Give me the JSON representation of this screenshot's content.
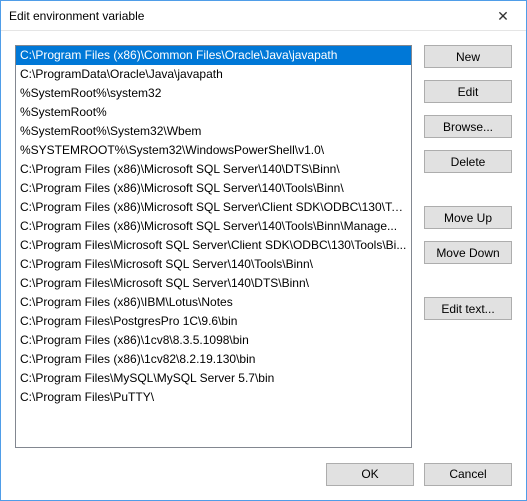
{
  "window": {
    "title": "Edit environment variable"
  },
  "list": {
    "selectedIndex": 0,
    "items": [
      "C:\\Program Files (x86)\\Common Files\\Oracle\\Java\\javapath",
      "C:\\ProgramData\\Oracle\\Java\\javapath",
      "%SystemRoot%\\system32",
      "%SystemRoot%",
      "%SystemRoot%\\System32\\Wbem",
      "%SYSTEMROOT%\\System32\\WindowsPowerShell\\v1.0\\",
      "C:\\Program Files (x86)\\Microsoft SQL Server\\140\\DTS\\Binn\\",
      "C:\\Program Files (x86)\\Microsoft SQL Server\\140\\Tools\\Binn\\",
      "C:\\Program Files (x86)\\Microsoft SQL Server\\Client SDK\\ODBC\\130\\To...",
      "C:\\Program Files (x86)\\Microsoft SQL Server\\140\\Tools\\Binn\\Manage...",
      "C:\\Program Files\\Microsoft SQL Server\\Client SDK\\ODBC\\130\\Tools\\Bi...",
      "C:\\Program Files\\Microsoft SQL Server\\140\\Tools\\Binn\\",
      "C:\\Program Files\\Microsoft SQL Server\\140\\DTS\\Binn\\",
      "C:\\Program Files (x86)\\IBM\\Lotus\\Notes",
      "C:\\Program Files\\PostgresPro 1C\\9.6\\bin",
      "C:\\Program Files (x86)\\1cv8\\8.3.5.1098\\bin",
      "C:\\Program Files (x86)\\1cv82\\8.2.19.130\\bin",
      "C:\\Program Files\\MySQL\\MySQL Server 5.7\\bin",
      "C:\\Program Files\\PuTTY\\"
    ]
  },
  "buttons": {
    "new": "New",
    "edit": "Edit",
    "browse": "Browse...",
    "delete": "Delete",
    "moveUp": "Move Up",
    "moveDown": "Move Down",
    "editText": "Edit text...",
    "ok": "OK",
    "cancel": "Cancel"
  },
  "icons": {
    "close": "✕"
  }
}
